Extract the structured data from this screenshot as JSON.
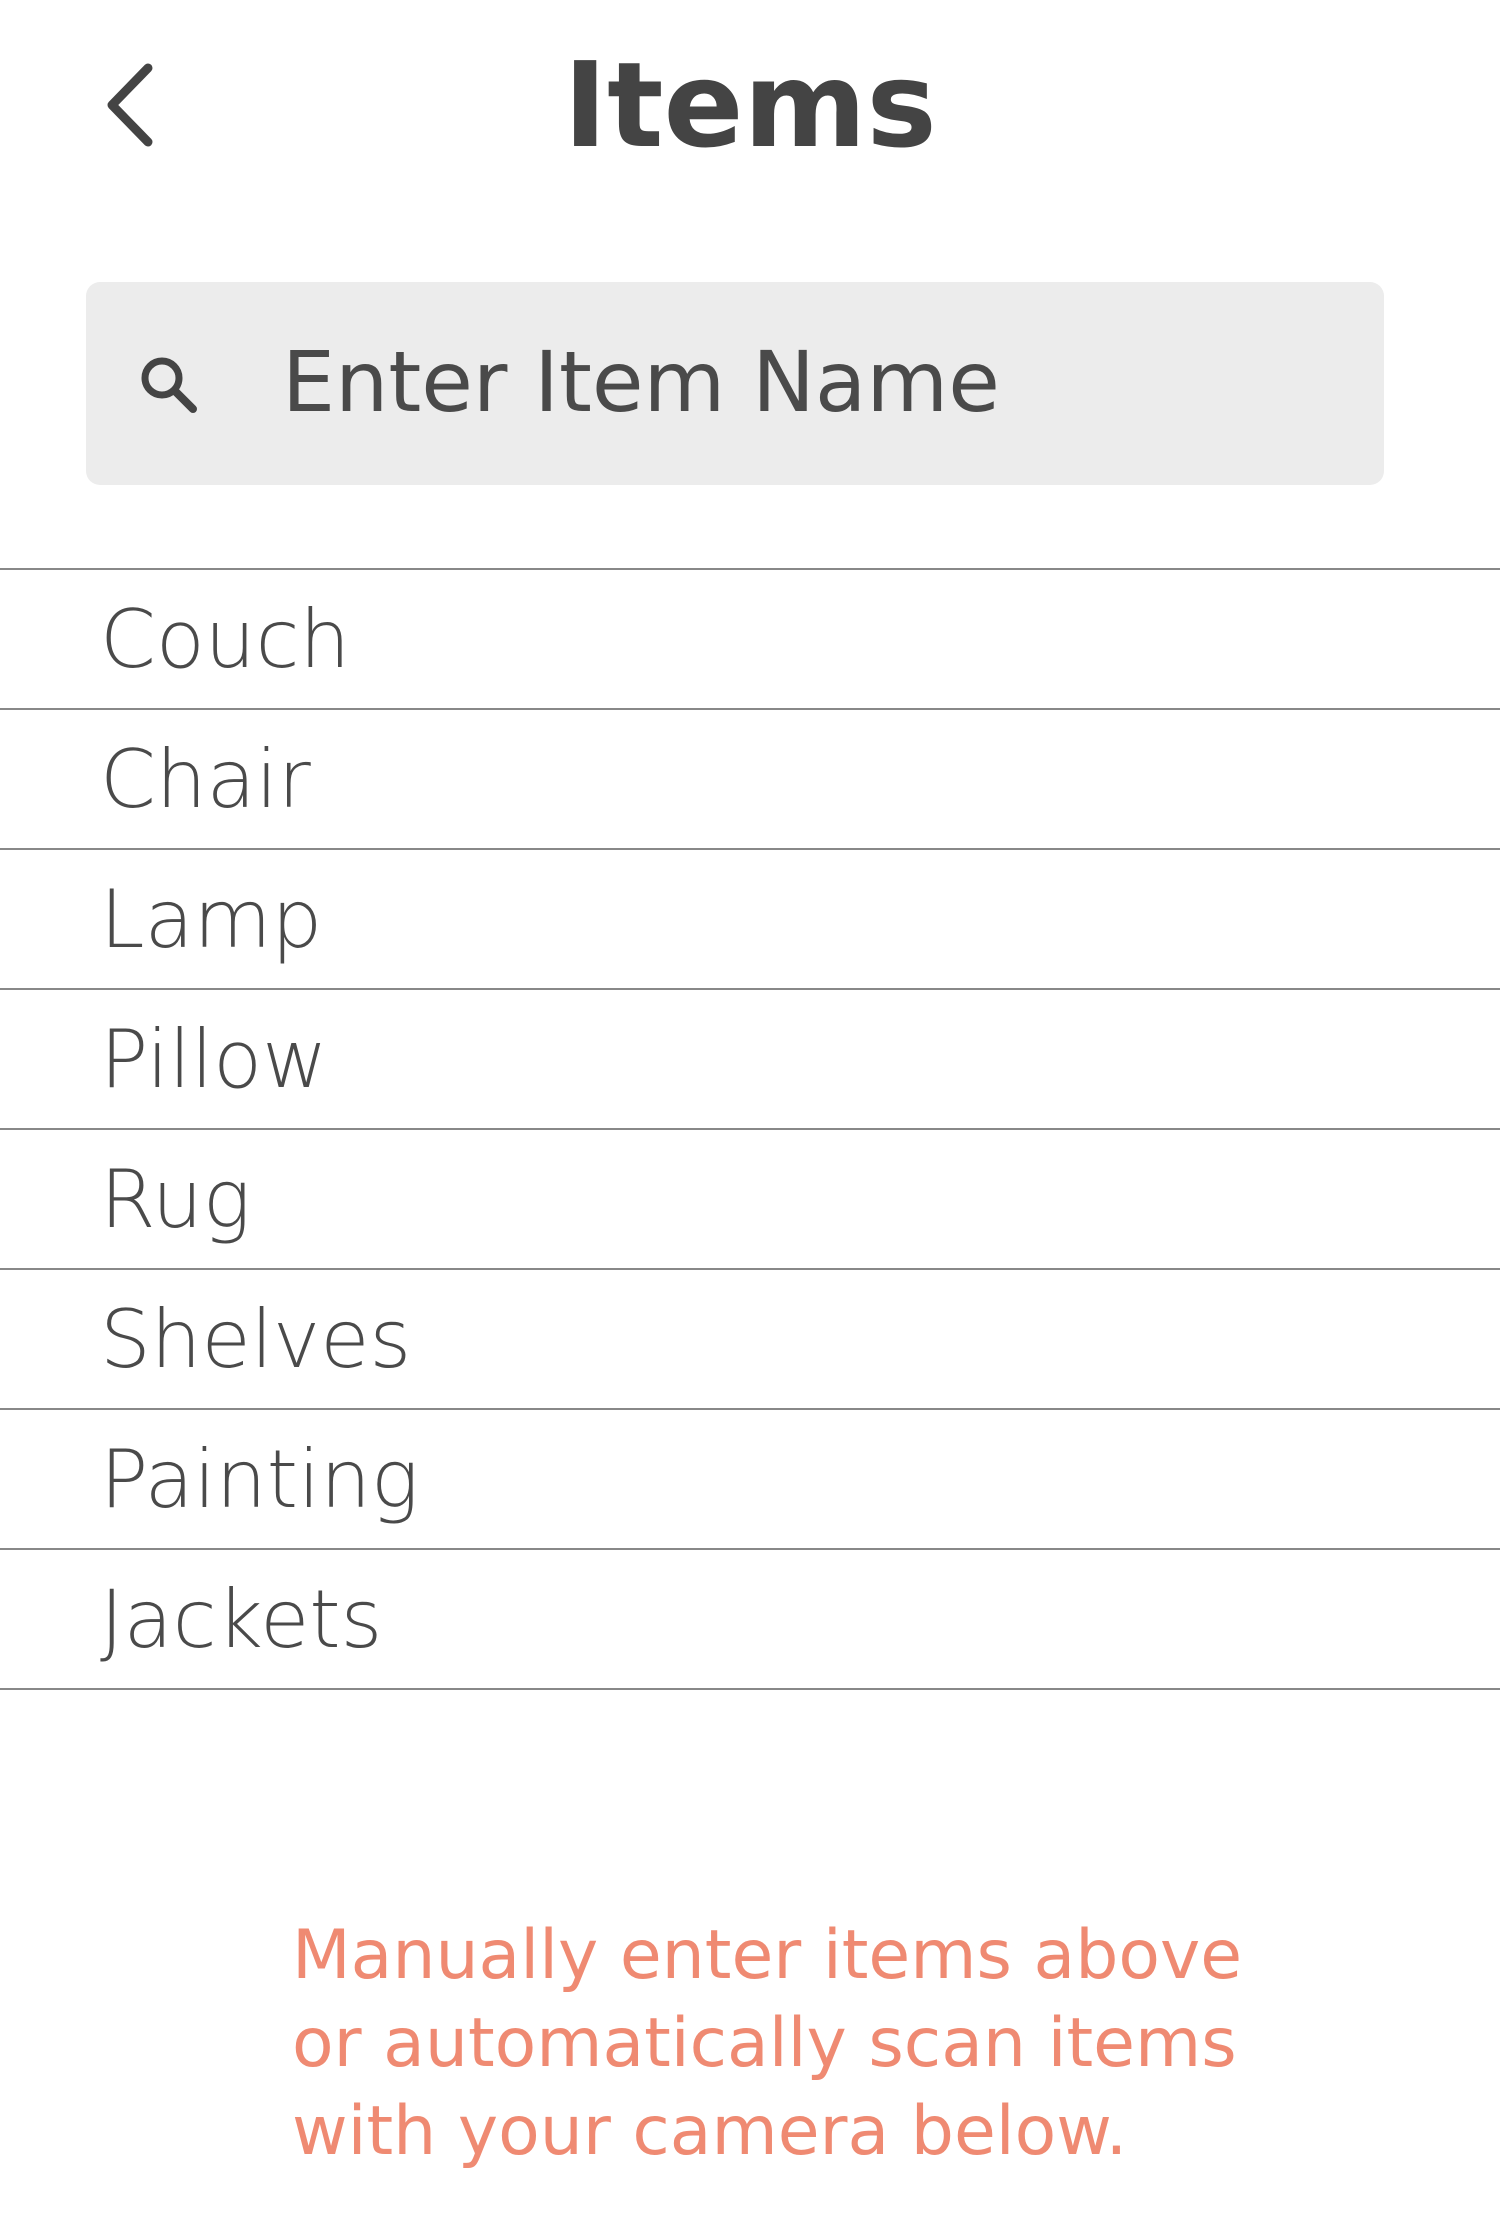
{
  "header": {
    "title": "Items",
    "back_icon": "chevron-left-icon"
  },
  "search": {
    "icon": "search-icon",
    "placeholder": "Enter Item Name",
    "value": ""
  },
  "items": [
    {
      "label": "Couch"
    },
    {
      "label": "Chair"
    },
    {
      "label": "Lamp"
    },
    {
      "label": "Pillow"
    },
    {
      "label": "Rug"
    },
    {
      "label": "Shelves"
    },
    {
      "label": "Painting"
    },
    {
      "label": "Jackets"
    }
  ],
  "hint": {
    "lines": [
      "Manually enter items above",
      "or automatically scan items",
      "with your camera below."
    ]
  },
  "colors": {
    "text": "#4a4a4a",
    "search_background": "#ececec",
    "divider": "#888888",
    "accent": "#ef8a72"
  }
}
